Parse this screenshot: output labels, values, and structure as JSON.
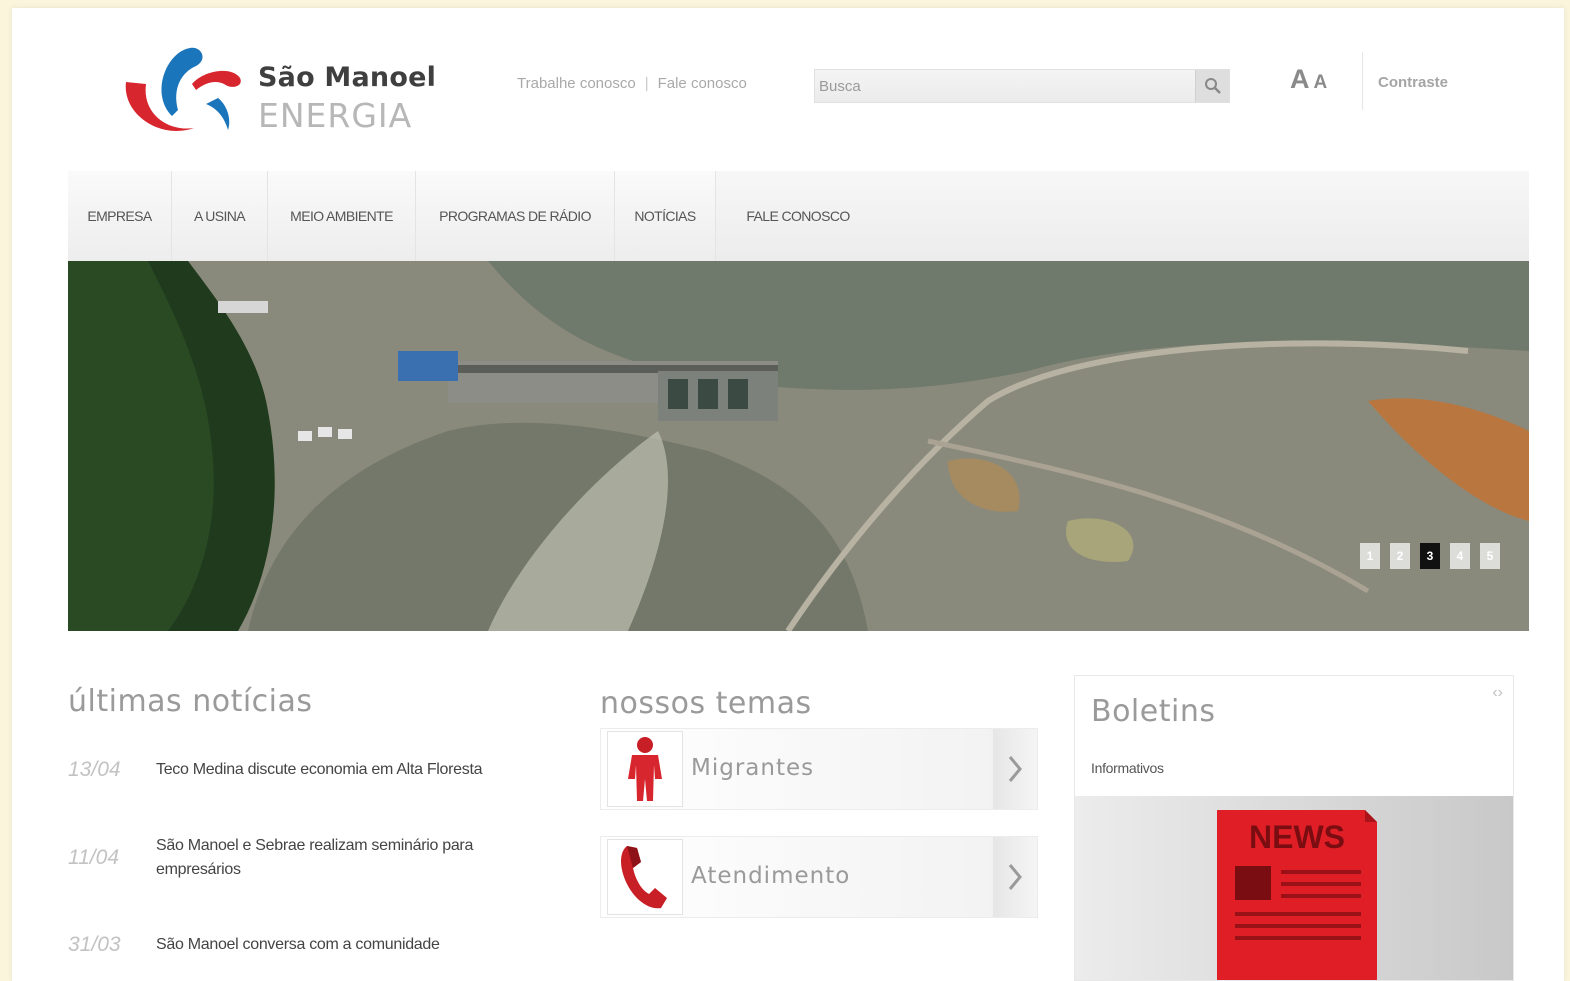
{
  "brand": {
    "name": "São Manoel",
    "sub": "ENERGIA",
    "colors": {
      "red": "#d8262f",
      "blue": "#1b75bb"
    }
  },
  "header": {
    "links": [
      "Trabalhe conosco",
      "Fale conosco"
    ],
    "search_placeholder": "Busca",
    "font_big": "A",
    "font_small": "A",
    "contrast_label": "Contraste"
  },
  "nav": {
    "items": [
      "EMPRESA",
      "A USINA",
      "MEIO AMBIENTE",
      "PROGRAMAS DE RÁDIO",
      "NOTÍCIAS",
      "FALE CONOSCO"
    ]
  },
  "hero": {
    "pager": [
      "1",
      "2",
      "3",
      "4",
      "5"
    ],
    "active_page": "3"
  },
  "news": {
    "title": "últimas notícias",
    "items": [
      {
        "date": "13/04",
        "text": "Teco Medina discute economia em Alta Floresta"
      },
      {
        "date": "11/04",
        "text": "São Manoel e Sebrae realizam seminário para empresários"
      },
      {
        "date": "31/03",
        "text": "São Manoel conversa com a comunidade"
      }
    ]
  },
  "themes": {
    "title": "nossos temas",
    "items": [
      {
        "label": "Migrantes",
        "icon": "person-icon"
      },
      {
        "label": "Atendimento",
        "icon": "phone-icon"
      }
    ]
  },
  "boletins": {
    "title": "Boletins",
    "subtitle": "Informativos",
    "image_text": "NEWS"
  }
}
